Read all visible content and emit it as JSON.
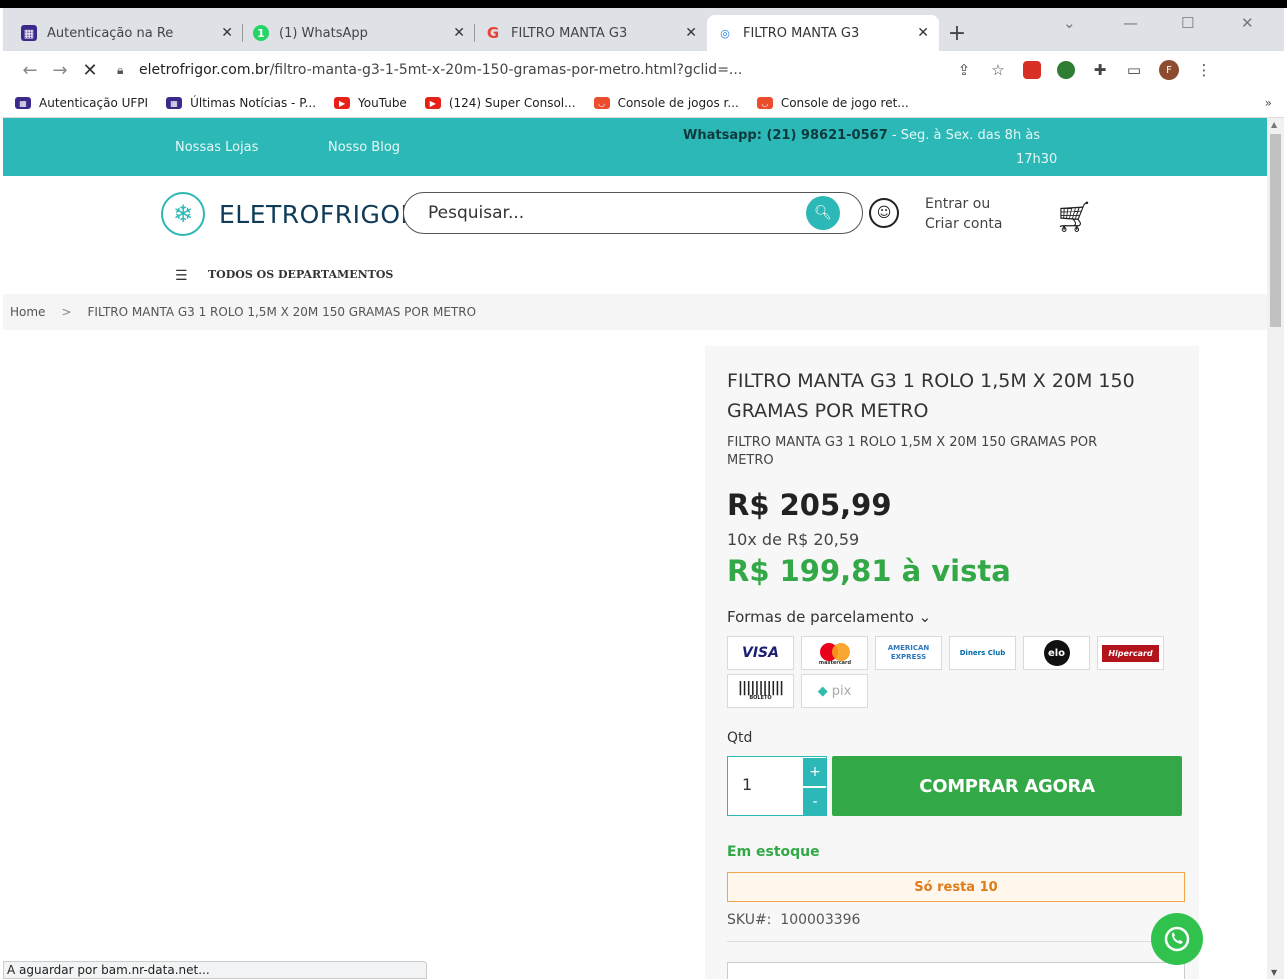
{
  "browser": {
    "tabs": [
      {
        "title": "Autenticação na Re",
        "favicon": "ufpi-icon",
        "active": false
      },
      {
        "title": "(1) WhatsApp",
        "favicon": "whatsapp-icon",
        "active": false
      },
      {
        "title": "FILTRO MANTA G3",
        "favicon": "google-icon",
        "active": false
      },
      {
        "title": "FILTRO MANTA G3",
        "favicon": "site-icon",
        "active": true
      }
    ],
    "url_host": "eletrofrigor.com.br",
    "url_path": "/filtro-manta-g3-1-5mt-x-20m-150-gramas-por-metro.html?gclid=...",
    "profile_initial": "F",
    "bookmarks": [
      {
        "label": "Autenticação UFPI",
        "icon": "ufpi-icon"
      },
      {
        "label": "Últimas Notícias - P...",
        "icon": "ufpi-icon"
      },
      {
        "label": "YouTube",
        "icon": "youtube-icon"
      },
      {
        "label": "(124) Super Consol...",
        "icon": "youtube-icon"
      },
      {
        "label": "Console de jogos r...",
        "icon": "shop-icon"
      },
      {
        "label": "Console de jogo ret...",
        "icon": "shop-icon"
      }
    ],
    "bookmarks_more": "»",
    "status_text": "A aguardar por bam.nr-data.net..."
  },
  "site": {
    "topbar": {
      "lojas": "Nossas Lojas",
      "blog": "Nosso Blog",
      "whatsapp_label": "Whatsapp",
      "whatsapp_number": "(21) 98621-0567",
      "hours": "- Seg. à Sex. das 8h às",
      "hours_end": "17h30",
      "color": "#2cb8b6"
    },
    "logo_text": "ELETROFRIGOR",
    "search_placeholder": "Pesquisar...",
    "login_line1": "Entrar ou",
    "login_line2": "Criar conta",
    "departments": "TODOS OS DEPARTAMENTOS",
    "breadcrumb": {
      "home": "Home",
      "separator": ">",
      "current": "FILTRO MANTA G3 1 ROLO 1,5M X 20M 150 GRAMAS POR METRO"
    }
  },
  "product": {
    "title": "FILTRO MANTA G3 1 ROLO 1,5M X 20M 150 GRAMAS POR METRO",
    "subtitle": "FILTRO MANTA G3 1 ROLO 1,5M X 20M 150 GRAMAS POR METRO",
    "price": "R$ 205,99",
    "installments": "10x de R$ 20,59",
    "cash_price": "R$ 199,81 à vista",
    "payment_toggle": "Formas de parcelamento ⌄",
    "payment_methods": [
      "VISA",
      "mastercard",
      "AMERICAN EXPRESS",
      "Diners Club",
      "elo",
      "Hipercard",
      "BOLETO",
      "pix"
    ],
    "qty_label": "Qtd",
    "qty_value": "1",
    "buy_label": "COMPRAR AGORA",
    "stock_label": "Em estoque",
    "remaining": "Só resta 10",
    "sku_label": "SKU#:",
    "sku_value": "100003396",
    "accent_green": "#32a846"
  }
}
